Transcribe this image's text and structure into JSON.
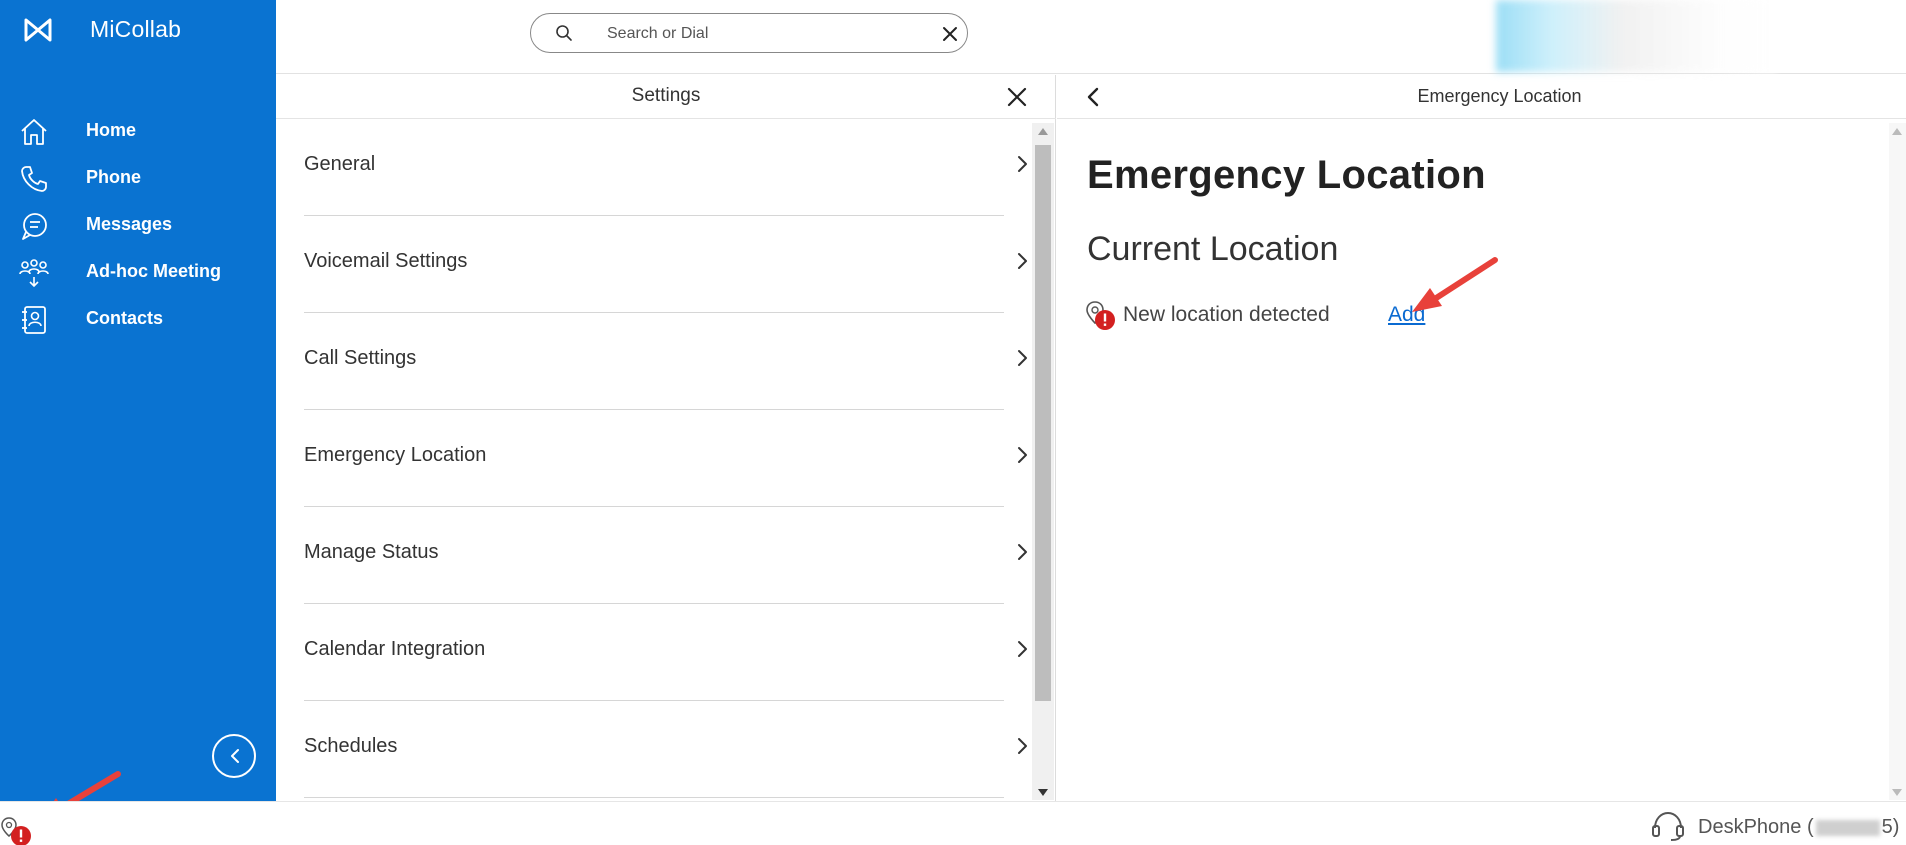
{
  "app": {
    "name": "MiCollab"
  },
  "sidebar": {
    "items": [
      {
        "label": "Home",
        "icon": "home-icon"
      },
      {
        "label": "Phone",
        "icon": "phone-icon"
      },
      {
        "label": "Messages",
        "icon": "messages-icon"
      },
      {
        "label": "Ad-hoc Meeting",
        "icon": "meeting-icon"
      },
      {
        "label": "Contacts",
        "icon": "contacts-icon"
      }
    ],
    "collapse_icon": "chevron-left-icon"
  },
  "search": {
    "placeholder": "Search or Dial",
    "value": ""
  },
  "settings": {
    "title": "Settings",
    "items": [
      {
        "label": "General"
      },
      {
        "label": "Voicemail Settings"
      },
      {
        "label": "Call Settings"
      },
      {
        "label": "Emergency Location"
      },
      {
        "label": "Manage Status"
      },
      {
        "label": "Calendar Integration"
      },
      {
        "label": "Schedules"
      }
    ]
  },
  "detail": {
    "header_title": "Emergency Location",
    "heading": "Emergency Location",
    "subheading": "Current Location",
    "status_text": "New location detected",
    "add_label": "Add"
  },
  "statusbar": {
    "device_prefix": "DeskPhone (",
    "device_suffix": "5)"
  },
  "colors": {
    "sidebar": "#0a73d1",
    "link": "#0a6ad1",
    "alert": "#d32020",
    "annotation_arrow": "#e8413a"
  }
}
